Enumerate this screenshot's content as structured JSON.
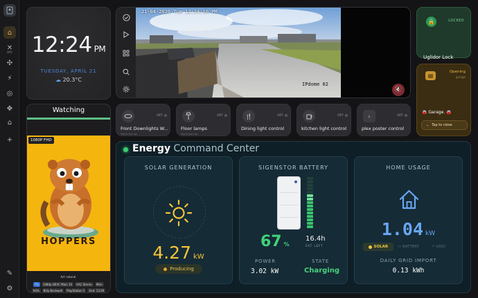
{
  "sidebar": {
    "items": [
      {
        "icon": "home-icon",
        "glyph": "⌂"
      },
      {
        "icon": "grid-icon",
        "glyph": "✕",
        "sub": "BYE"
      },
      {
        "icon": "fan-icon",
        "glyph": "✣"
      },
      {
        "icon": "lightbulb-icon",
        "glyph": "⚡"
      },
      {
        "icon": "target-icon",
        "glyph": "◎"
      },
      {
        "icon": "move-icon",
        "glyph": "✥"
      },
      {
        "icon": "house-icon",
        "glyph": "⌂"
      },
      {
        "icon": "plus-icon",
        "glyph": "+"
      }
    ],
    "bottom": [
      {
        "icon": "pencil-icon",
        "glyph": "✎"
      },
      {
        "icon": "gear-icon",
        "glyph": "⚙"
      }
    ]
  },
  "clock": {
    "time": "12:24",
    "ampm": "PM",
    "date": "TUESDAY, APRIL 21",
    "weather": "20.3°C"
  },
  "camera": {
    "timestamp": "21-04-2026 Tue 12:24:10 PM",
    "label": "IPdome 02"
  },
  "lock": {
    "state": "LOCKED",
    "name": "Uglidor Lock"
  },
  "garage": {
    "state": "Opening",
    "sub": "garage",
    "name": "Garage.",
    "button": "Tap to close"
  },
  "watching": {
    "title": "Watching",
    "progress": 1.0,
    "quality": "1080P FHD",
    "poster_title": "HOPPERS",
    "footer": "Act natural.",
    "tags": [
      "PG",
      "1080p HEVC Main 10",
      "AAC Stereo",
      "96m",
      "94%",
      "Billy Beckwell",
      "PlayStation 5",
      "End: 13:29"
    ]
  },
  "lights": [
    {
      "name": "Front Downlights W...",
      "state": "OFF",
      "hint": "Tap to turn on"
    },
    {
      "name": "Floor lamps",
      "state": "OFF",
      "hint": "Tap to turn on"
    },
    {
      "name": "Dining light control",
      "state": "OFF",
      "hint": ""
    },
    {
      "name": "kitchen light control",
      "state": "OFF",
      "hint": ""
    },
    {
      "name": "plex poster control",
      "state": "OFF",
      "hint": ""
    }
  ],
  "energy": {
    "title_bold": "Energy",
    "title_rest": "Command Center",
    "solar": {
      "label": "SOLAR GENERATION",
      "value": "4.27",
      "unit": "kW",
      "status": "Producing"
    },
    "battery": {
      "label": "SIGENSTOR BATTERY",
      "percent": "67",
      "percent_unit": "%",
      "level": 0.67,
      "time": "16.4h",
      "time_label": "EST. LEFT",
      "power_label": "POWER",
      "power": "3.02 kW",
      "state_label": "STATE",
      "state": "Charging"
    },
    "home": {
      "label": "HOME USAGE",
      "value": "1.04",
      "unit": "kW",
      "sources": [
        "SOLAR",
        "BATTERY",
        "GRID"
      ],
      "grid_label": "DAILY GRID IMPORT",
      "grid_value": "0.13 kWh"
    }
  },
  "colors": {
    "accent": "#e7a74a",
    "solar": "#f5c43b",
    "battery": "#3fd27a",
    "home": "#68a6f2"
  }
}
